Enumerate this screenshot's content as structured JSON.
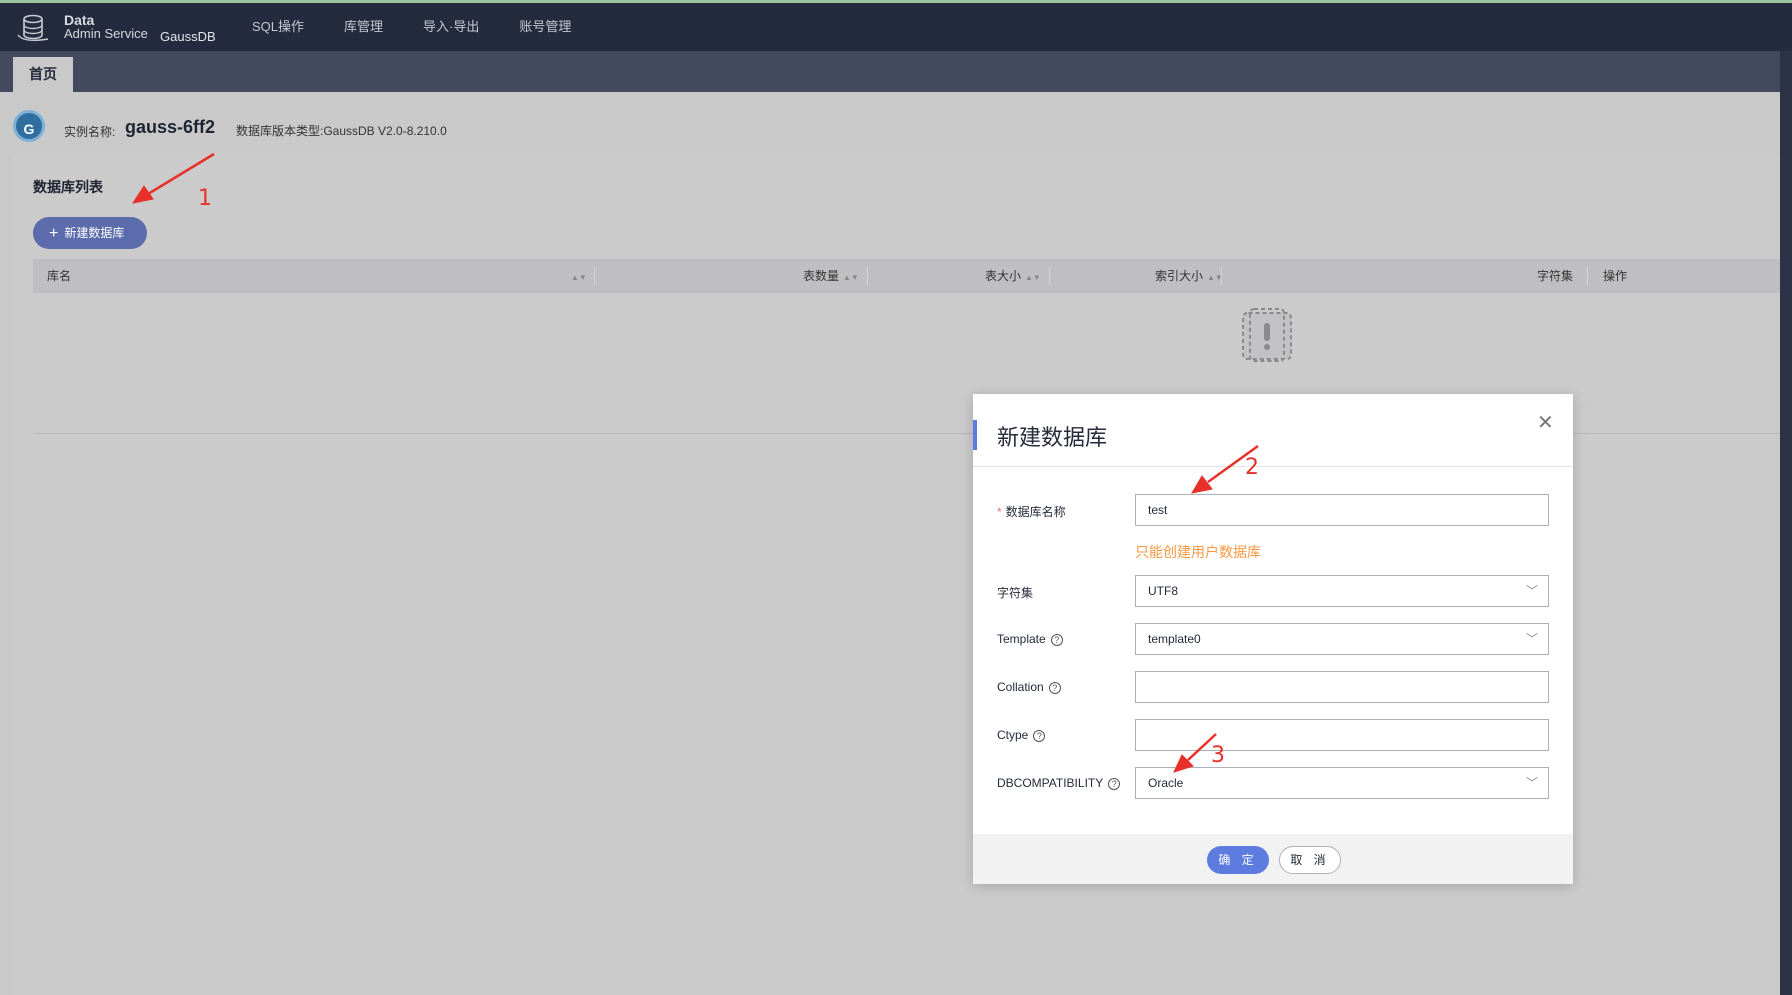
{
  "app": {
    "logo_line1": "Data",
    "logo_line2": "Admin Service",
    "product": "GaussDB"
  },
  "nav": {
    "items": [
      {
        "label": "SQL操作"
      },
      {
        "label": "库管理"
      },
      {
        "label": "导入·导出"
      },
      {
        "label": "账号管理"
      }
    ]
  },
  "tabs": {
    "home": "首页"
  },
  "instance": {
    "icon_letter": "G",
    "label": "实例名称:",
    "name": "gauss-6ff2",
    "version_text": "数据库版本类型:GaussDB V2.0-8.210.0"
  },
  "db_list": {
    "title": "数据库列表",
    "new_button": "新建数据库",
    "columns": [
      "库名",
      "表数量",
      "表大小",
      "索引大小",
      "字符集",
      "操作"
    ],
    "rows": []
  },
  "modal": {
    "title": "新建数据库",
    "fields": {
      "db_name": {
        "label": "数据库名称",
        "value": "test"
      },
      "charset": {
        "label": "字符集",
        "value": "UTF8"
      },
      "template": {
        "label": "Template",
        "value": "template0"
      },
      "collation": {
        "label": "Collation",
        "value": ""
      },
      "ctype": {
        "label": "Ctype",
        "value": ""
      },
      "dbcompat": {
        "label": "DBCOMPATIBILITY",
        "value": "Oracle"
      }
    },
    "hint": "只能创建用户数据库",
    "ok_label": "确 定",
    "cancel_label": "取 消"
  },
  "annotations": {
    "n1": "1",
    "n2": "2",
    "n3": "3",
    "color": "#e8302a"
  },
  "colors": {
    "topbar": "#242b3e",
    "primary": "#5e7ce0",
    "hint": "#fa9841"
  }
}
